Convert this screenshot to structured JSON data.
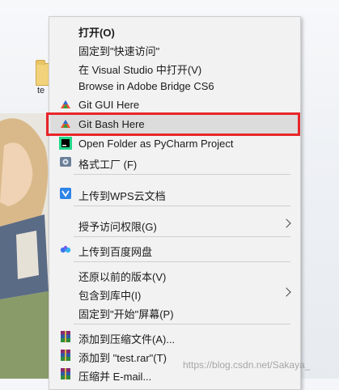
{
  "desktop": {
    "icon_label": "te"
  },
  "menu": {
    "items": [
      {
        "label": "打开(O)",
        "bold": true
      },
      {
        "label": "固定到\"快速访问\""
      },
      {
        "label": "在 Visual Studio 中打开(V)"
      },
      {
        "label": "Browse in Adobe Bridge CS6"
      },
      {
        "label": "Git GUI Here"
      },
      {
        "label": "Git Bash Here"
      },
      {
        "label": "Open Folder as PyCharm Project"
      },
      {
        "label": "格式工厂 (F)"
      },
      {
        "label": "上传到WPS云文档"
      },
      {
        "label": "授予访问权限(G)"
      },
      {
        "label": "上传到百度网盘"
      },
      {
        "label": "还原以前的版本(V)"
      },
      {
        "label": "包含到库中(I)"
      },
      {
        "label": "固定到\"开始\"屏幕(P)"
      },
      {
        "label": "添加到压缩文件(A)..."
      },
      {
        "label": "添加到 \"test.rar\"(T)"
      },
      {
        "label": "压缩并 E-mail..."
      }
    ]
  },
  "highlight_color": "#e8262a",
  "watermark": "https://blog.csdn.net/Sakaya_"
}
